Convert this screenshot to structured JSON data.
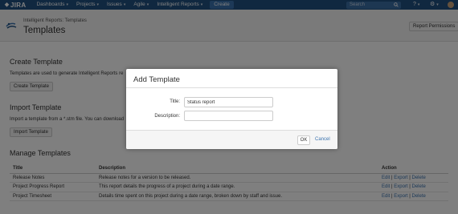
{
  "topbar": {
    "logo": "JIRA",
    "nav": [
      "Dashboards",
      "Projects",
      "Issues",
      "Agile",
      "Intelligent Reports"
    ],
    "create_label": "Create",
    "search_placeholder": "Search",
    "help_icon": "question-icon",
    "settings_icon": "gear-icon",
    "brand_color": "#205081"
  },
  "header": {
    "breadcrumb": "Intelligent Reports: Templates",
    "title": "Templates",
    "permissions_button": "Report Permissions"
  },
  "create_section": {
    "heading": "Create Template",
    "text": "Templates are used to generate Intelligent Reports re",
    "button": "Create Template"
  },
  "import_section": {
    "heading": "Import Template",
    "text": "Import a template from a *.stm file. You can download",
    "button": "Import Template"
  },
  "manage_section": {
    "heading": "Manage Templates",
    "columns": [
      "Title",
      "Description",
      "Action"
    ],
    "rows": [
      {
        "title": "Release Notes",
        "description": "Release notes for a version to be released."
      },
      {
        "title": "Project Progress Report",
        "description": "This report details the progress of a project during a date range."
      },
      {
        "title": "Project Timesheet",
        "description": "Details time spent on this project during a date range, broken down by staff and issue."
      }
    ],
    "actions": {
      "edit": "Edit",
      "export": "Export",
      "delete": "Delete",
      "separator": "|"
    }
  },
  "dialog": {
    "title": "Add Template",
    "title_label": "Title:",
    "title_value": "Status report",
    "description_label": "Description:",
    "description_value": "",
    "ok_label": "OK",
    "cancel_label": "Cancel"
  }
}
